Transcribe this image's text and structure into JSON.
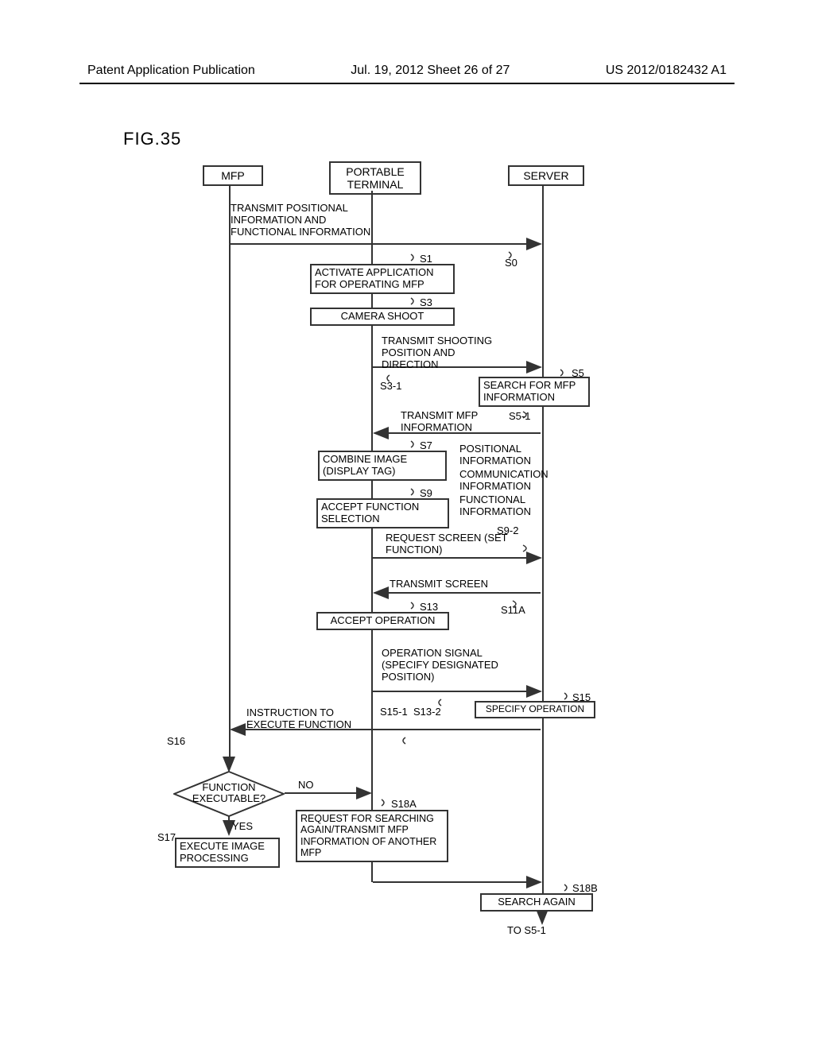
{
  "header": {
    "left": "Patent Application Publication",
    "center": "Jul. 19, 2012  Sheet 26 of 27",
    "right": "US 2012/0182432 A1"
  },
  "figure_label": "FIG.35",
  "lanes": {
    "mfp": "MFP",
    "terminal": "PORTABLE TERMINAL",
    "server": "SERVER"
  },
  "labels": {
    "transmit_pos_func": "TRANSMIT POSITIONAL INFORMATION AND FUNCTIONAL INFORMATION",
    "activate_app": "ACTIVATE APPLICATION FOR OPERATING MFP",
    "camera_shoot": "CAMERA SHOOT",
    "transmit_shoot": "TRANSMIT SHOOTING POSITION AND DIRECTION",
    "search_mfp": "SEARCH FOR MFP INFORMATION",
    "transmit_mfp_info": "TRANSMIT MFP INFORMATION",
    "combine_image": "COMBINE IMAGE (DISPLAY TAG)",
    "info_side1": "POSITIONAL INFORMATION",
    "info_side2": "COMMUNICATION INFORMATION",
    "info_side3": "FUNCTIONAL INFORMATION",
    "accept_function": "ACCEPT FUNCTION SELECTION",
    "request_screen": "REQUEST SCREEN (SET FUNCTION)",
    "transmit_screen": "TRANSMIT SCREEN",
    "accept_operation": "ACCEPT OPERATION",
    "operation_signal": "OPERATION SIGNAL (SPECIFY DESIGNATED POSITION)",
    "specify_operation": "SPECIFY OPERATION",
    "instruction_execute": "INSTRUCTION TO EXECUTE FUNCTION",
    "function_executable": "FUNCTION EXECUTABLE?",
    "yes": "YES",
    "no": "NO",
    "execute_image": "EXECUTE IMAGE PROCESSING",
    "request_search_again": "REQUEST FOR SEARCHING AGAIN/TRANSMIT MFP INFORMATION OF ANOTHER MFP",
    "search_again": "SEARCH AGAIN",
    "to_s51": "TO S5-1"
  },
  "steps": {
    "s0": "S0",
    "s1": "S1",
    "s3": "S3",
    "s3_1": "S3-1",
    "s5": "S5",
    "s5_1": "S5-1",
    "s7": "S7",
    "s9": "S9",
    "s9_2": "S9-2",
    "s11a": "S11A",
    "s13": "S13",
    "s13_2": "S13-2",
    "s15": "S15",
    "s15_1": "S15-1",
    "s16": "S16",
    "s17": "S17",
    "s18a": "S18A",
    "s18b": "S18B"
  }
}
